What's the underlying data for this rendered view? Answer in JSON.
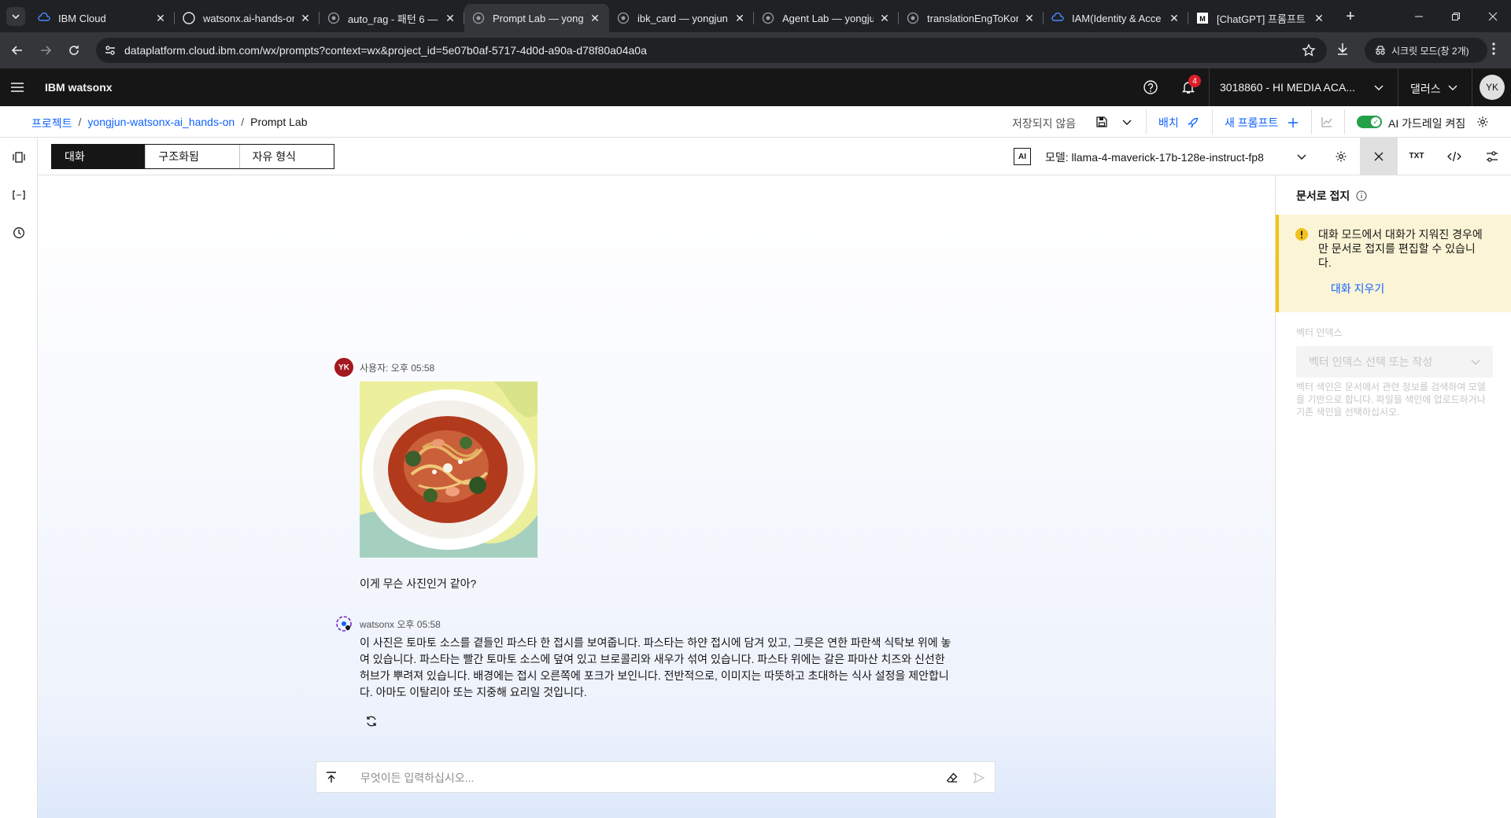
{
  "browser": {
    "tabs": [
      {
        "title": "IBM Cloud",
        "icon": "ibm-cloud-icon"
      },
      {
        "title": "watsonx.ai-hands-on",
        "icon": "github-icon"
      },
      {
        "title": "auto_rag - 패턴 6 —",
        "icon": "watsonx-icon"
      },
      {
        "title": "Prompt Lab — yong",
        "icon": "watsonx-icon",
        "active": true
      },
      {
        "title": "ibk_card — yongjun",
        "icon": "watsonx-icon"
      },
      {
        "title": "Agent Lab — yongju",
        "icon": "watsonx-icon"
      },
      {
        "title": "translationEngToKor",
        "icon": "watsonx-icon"
      },
      {
        "title": "IAM(Identity & Acce",
        "icon": "ibm-cloud-icon"
      },
      {
        "title": "[ChatGPT] 프롬프트",
        "icon": "medium-icon"
      }
    ],
    "url": "dataplatform.cloud.ibm.com/wx/prompts?context=wx&project_id=5e07b0af-5717-4d0d-a90a-d78f80a04a0a",
    "incognito_label": "시크릿 모드(창 2개)"
  },
  "header": {
    "brand": "IBM watsonx",
    "notification_count": "4",
    "account": "3018860 - HI MEDIA ACA...",
    "region": "댈러스",
    "avatar_initials": "YK"
  },
  "breadcrumb": {
    "items": [
      "프로젝트",
      "yongjun-watsonx-ai_hands-on",
      "Prompt Lab"
    ],
    "separator": "/"
  },
  "actions": {
    "unsaved": "저장되지 않음",
    "deploy": "배치",
    "new_prompt": "새 프롬프트",
    "guardrails": "AI 가드레일 켜짐"
  },
  "toolbar": {
    "modes": [
      "대화",
      "구조화됨",
      "자유 형식"
    ],
    "active_mode": "대화",
    "ai_badge": "AI",
    "model_label": "모델: llama-4-maverick-17b-128e-instruct-fp8",
    "txt_label": "TXT"
  },
  "chat": {
    "user": {
      "avatar": "YK",
      "header": "사용자: 오후 05:58",
      "image": "pasta-photo",
      "text": "이게 무슨 사진인거 같아?"
    },
    "assistant": {
      "header": "watsonx 오후 05:58",
      "text": "이 사진은 토마토 소스를 곁들인 파스타 한 접시를 보여줍니다. 파스타는 하얀 접시에 담겨 있고, 그릇은 연한 파란색 식탁보 위에 놓여 있습니다. 파스타는 빨간 토마토 소스에 덮여 있고 브로콜리와 새우가 섞여 있습니다. 파스타 위에는 갈은 파마산 치즈와 신선한 허브가 뿌려져 있습니다. 배경에는 접시 오른쪽에 포크가 보인니다. 전반적으로, 이미지는 따뜻하고 초대하는 식사 설정을 제안합니다. 아마도 이탈리아 또는 지중해 요리일 것입니다."
    },
    "composer_placeholder": "무엇이든 입력하십시오..."
  },
  "panel": {
    "title": "문서로 접지",
    "notice": "대화 모드에서 대화가 지워진 경우에만 문서로 접지를 편집할 수 있습니다.",
    "notice_link": "대화 지우기",
    "vector_label": "벡터 인덱스",
    "vector_placeholder": "벡터 인덱스 선택 또는 작성",
    "vector_help": "벡터 색인은 문서에서 관련 정보를 검색하여 모델을 기반으로 합니다. 파일을 색인에 업로드하거나 기존 색인을 선택하십시오."
  },
  "colors": {
    "accent": "#0f62fe",
    "header_bg": "#161616",
    "toggle_on": "#24a148",
    "notice_bg": "#fcf4d6",
    "notice_border": "#f1c21b",
    "user_avatar": "#a2191f"
  }
}
